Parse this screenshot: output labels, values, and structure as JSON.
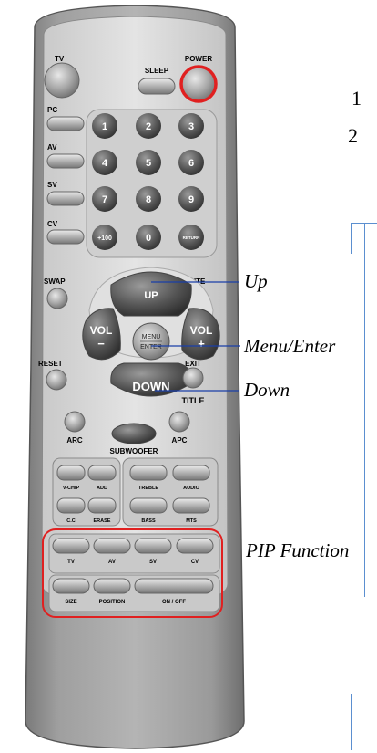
{
  "remote": {
    "buttons": {
      "tv": "TV",
      "pc": "PC",
      "av": "AV",
      "sv": "SV",
      "cv": "CV",
      "sleep": "SLEEP",
      "power": "POWER",
      "digits": [
        "1",
        "2",
        "3",
        "4",
        "5",
        "6",
        "7",
        "8",
        "9"
      ],
      "plus100": "+100",
      "zero": "0",
      "return": "RETURN",
      "swap": "SWAP",
      "mute": "MUTE",
      "up": "UP",
      "down": "DOWN",
      "vol": "VOL",
      "vol_minus": "−",
      "vol_plus": "+",
      "menu": "MENU",
      "enter": "ENTER",
      "reset": "RESET",
      "exit": "EXIT",
      "title": "TITLE",
      "arc": "ARC",
      "apc": "APC",
      "subwoofer": "SUBWOOFER",
      "vchip": "V-CHIP",
      "add": "ADD",
      "cc": "C.C",
      "erase": "ERASE",
      "treble": "TREBLE",
      "audio": "AUDIO",
      "bass": "BASS",
      "mts": "MTS",
      "pip_tv": "TV",
      "pip_av": "AV",
      "pip_sv": "SV",
      "pip_cv": "CV",
      "size": "SIZE",
      "position": "POSITION",
      "onoff": "ON / OFF"
    }
  },
  "callouts": {
    "up": "Up",
    "menu_enter": "Menu/Enter",
    "down": "Down",
    "pip": "PIP Function"
  },
  "markers": [
    "1",
    "2"
  ],
  "colors": {
    "body_outer": "#8c8c8c",
    "body_face": "#d4d4d4",
    "button_gray": "#9a9a9a",
    "button_dark": "#5a5a5a",
    "power_ring": "#e02020",
    "highlight_red": "#e02020",
    "leader_blue": "#1a3fa8",
    "frame_blue": "#5b8fd0"
  }
}
